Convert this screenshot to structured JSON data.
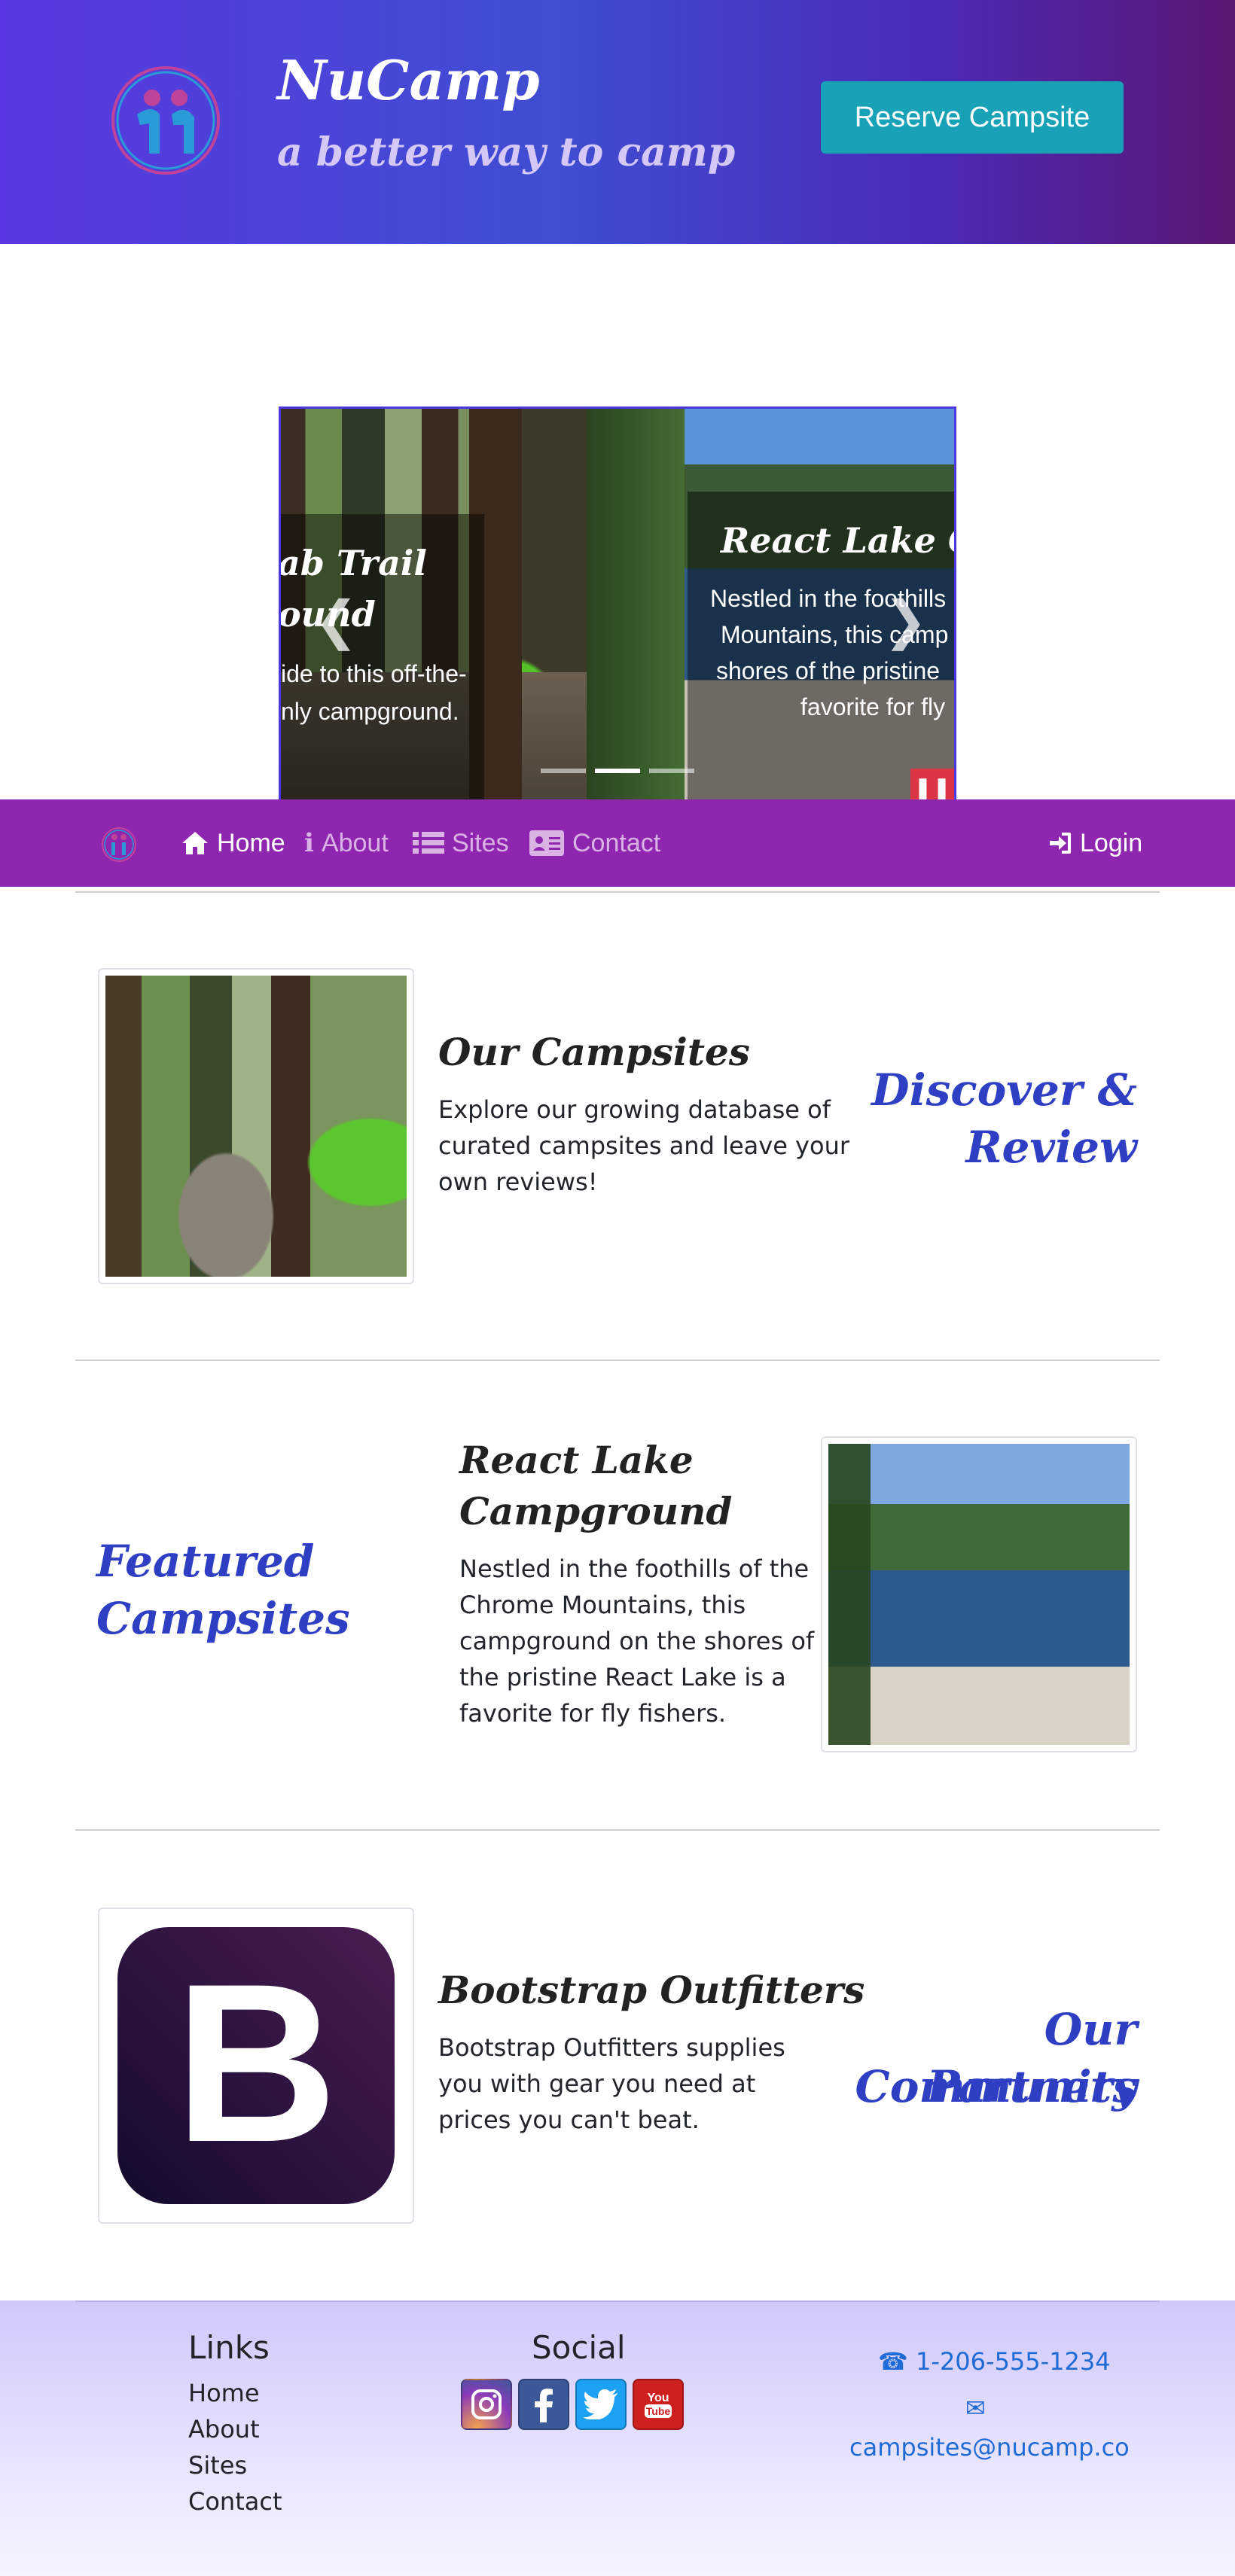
{
  "header": {
    "brand": "NuCamp",
    "tagline": "a better way to camp",
    "reserve_button": "Reserve Campsite",
    "colors": {
      "gradient_start": "#5a37e0",
      "gradient_end": "#5b1773",
      "button": "#17a2b8"
    }
  },
  "carousel": {
    "slides": [
      {
        "title_visible": "ab Trail",
        "title_line2_visible": "ound",
        "text_line1": "ide to this off-the-",
        "text_line2": "nly campground."
      },
      {
        "title_visible": "React Lake Ca",
        "text_line1": "Nestled in the foothills",
        "text_line2": "Mountains, this camp",
        "text_line3": "shores of the pristine",
        "text_line4": "favorite for fly"
      }
    ],
    "prev_icon": "chevron-left-icon",
    "next_icon": "chevron-right-icon",
    "pause_icon": "pause-icon"
  },
  "navbar": {
    "items": [
      {
        "label": "Home",
        "icon": "home-icon",
        "active": true
      },
      {
        "label": "About",
        "icon": "info-icon",
        "active": false
      },
      {
        "label": "Sites",
        "icon": "list-icon",
        "active": false
      },
      {
        "label": "Contact",
        "icon": "address-card-icon",
        "active": false
      }
    ],
    "login": "Login",
    "background": "#8f26b0"
  },
  "rows": [
    {
      "title": "Our Campsites",
      "text_lines": [
        "Explore our growing database of",
        "curated campsites and leave your",
        "own reviews!"
      ],
      "heading_lines": [
        "Discover &",
        "Review"
      ]
    },
    {
      "title_lines": [
        "React Lake",
        "Campground"
      ],
      "text_lines": [
        "Nestled in the foothills of the",
        "Chrome Mountains, this",
        "campground on the shores of",
        "the pristine React Lake is a",
        "favorite for fly fishers."
      ],
      "heading_lines": [
        "Featured",
        "Campsites"
      ]
    },
    {
      "title": "Bootstrap Outfitters",
      "text_lines": [
        "Bootstrap Outfitters supplies",
        "you with gear you need at",
        "prices you can't beat."
      ],
      "heading_lines": [
        "Our Community",
        "Partners"
      ],
      "logo_letter": "B"
    }
  ],
  "footer": {
    "links_heading": "Links",
    "links": [
      "Home",
      "About",
      "Sites",
      "Contact"
    ],
    "social_heading": "Social",
    "social_icons": [
      "instagram-icon",
      "facebook-icon",
      "twitter-icon",
      "youtube-icon"
    ],
    "phone": "1-206-555-1234",
    "email": "campsites@nucamp.co"
  }
}
